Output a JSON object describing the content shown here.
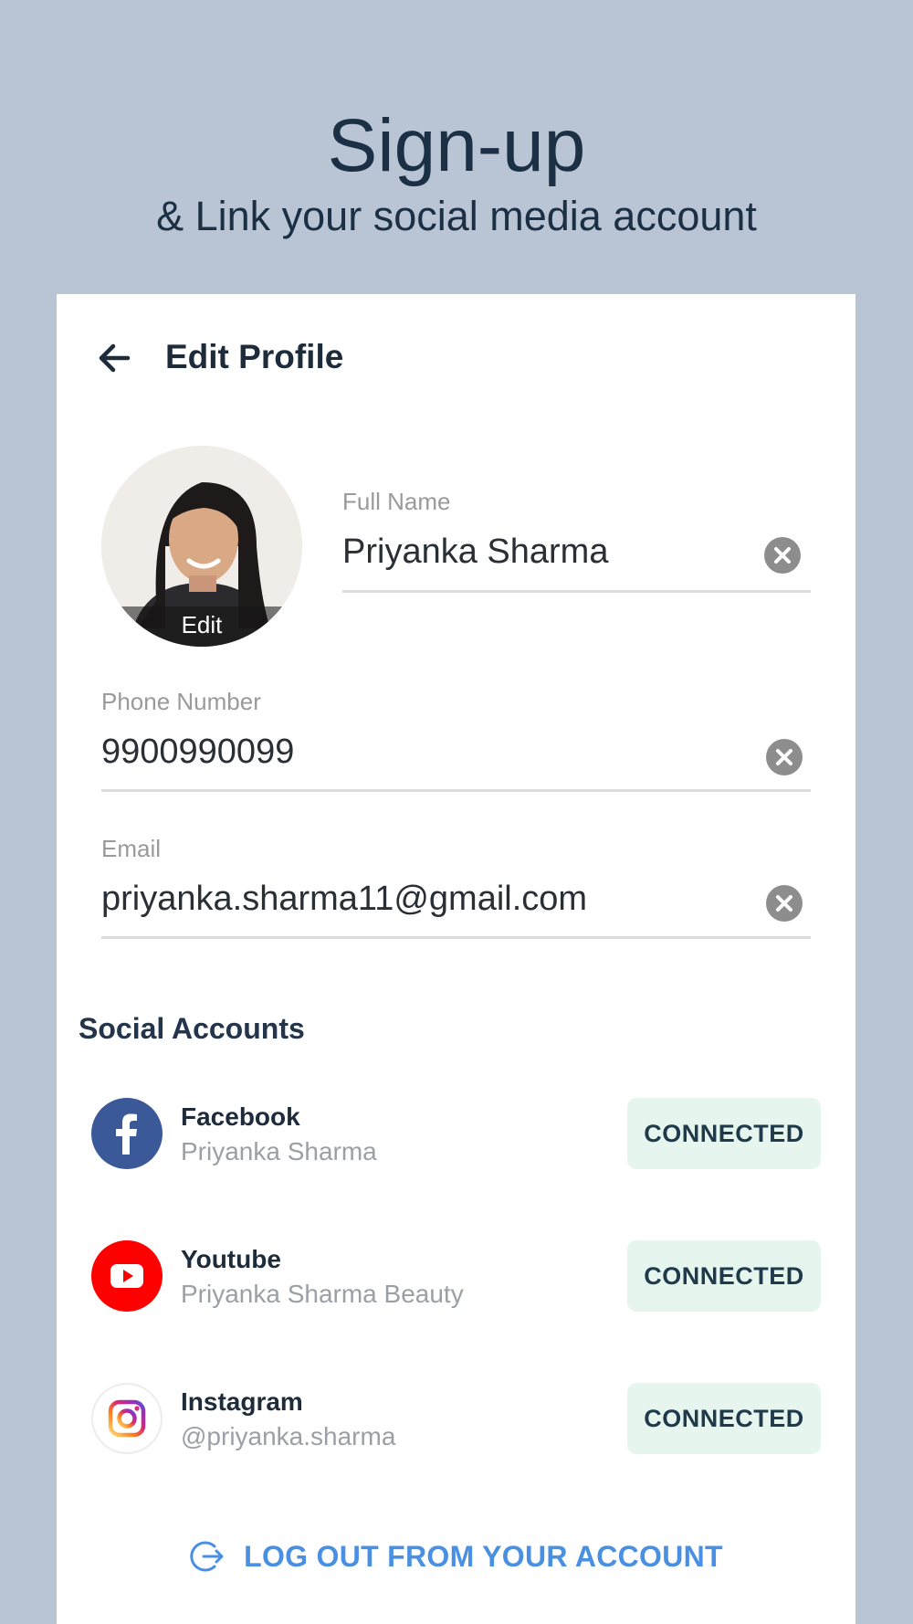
{
  "hero": {
    "title": "Sign-up",
    "subtitle": "& Link your social media account"
  },
  "topbar": {
    "title": "Edit Profile",
    "back_icon": "arrow-left-icon"
  },
  "avatar": {
    "edit_label": "Edit"
  },
  "form": {
    "full_name": {
      "label": "Full Name",
      "value": "Priyanka Sharma"
    },
    "phone": {
      "label": "Phone Number",
      "value": "9900990099"
    },
    "email": {
      "label": "Email",
      "value": "priyanka.sharma11@gmail.com"
    }
  },
  "social": {
    "title": "Social Accounts",
    "accounts": [
      {
        "name": "Facebook",
        "handle": "Priyanka Sharma",
        "status": "CONNECTED",
        "icon": "facebook-icon",
        "color": "#3b5998"
      },
      {
        "name": "Youtube",
        "handle": "Priyanka Sharma Beauty",
        "status": "CONNECTED",
        "icon": "youtube-icon",
        "color": "#ff0000"
      },
      {
        "name": "Instagram",
        "handle": "@priyanka.sharma",
        "status": "CONNECTED",
        "icon": "instagram-icon",
        "color": "#c13584"
      }
    ]
  },
  "logout": {
    "label": "LOG OUT FROM YOUR ACCOUNT",
    "icon": "logout-icon",
    "color": "#4a90e2"
  },
  "colors": {
    "background": "#b9c5d4",
    "card": "#ffffff",
    "connected_bg": "#e6f6ef"
  }
}
